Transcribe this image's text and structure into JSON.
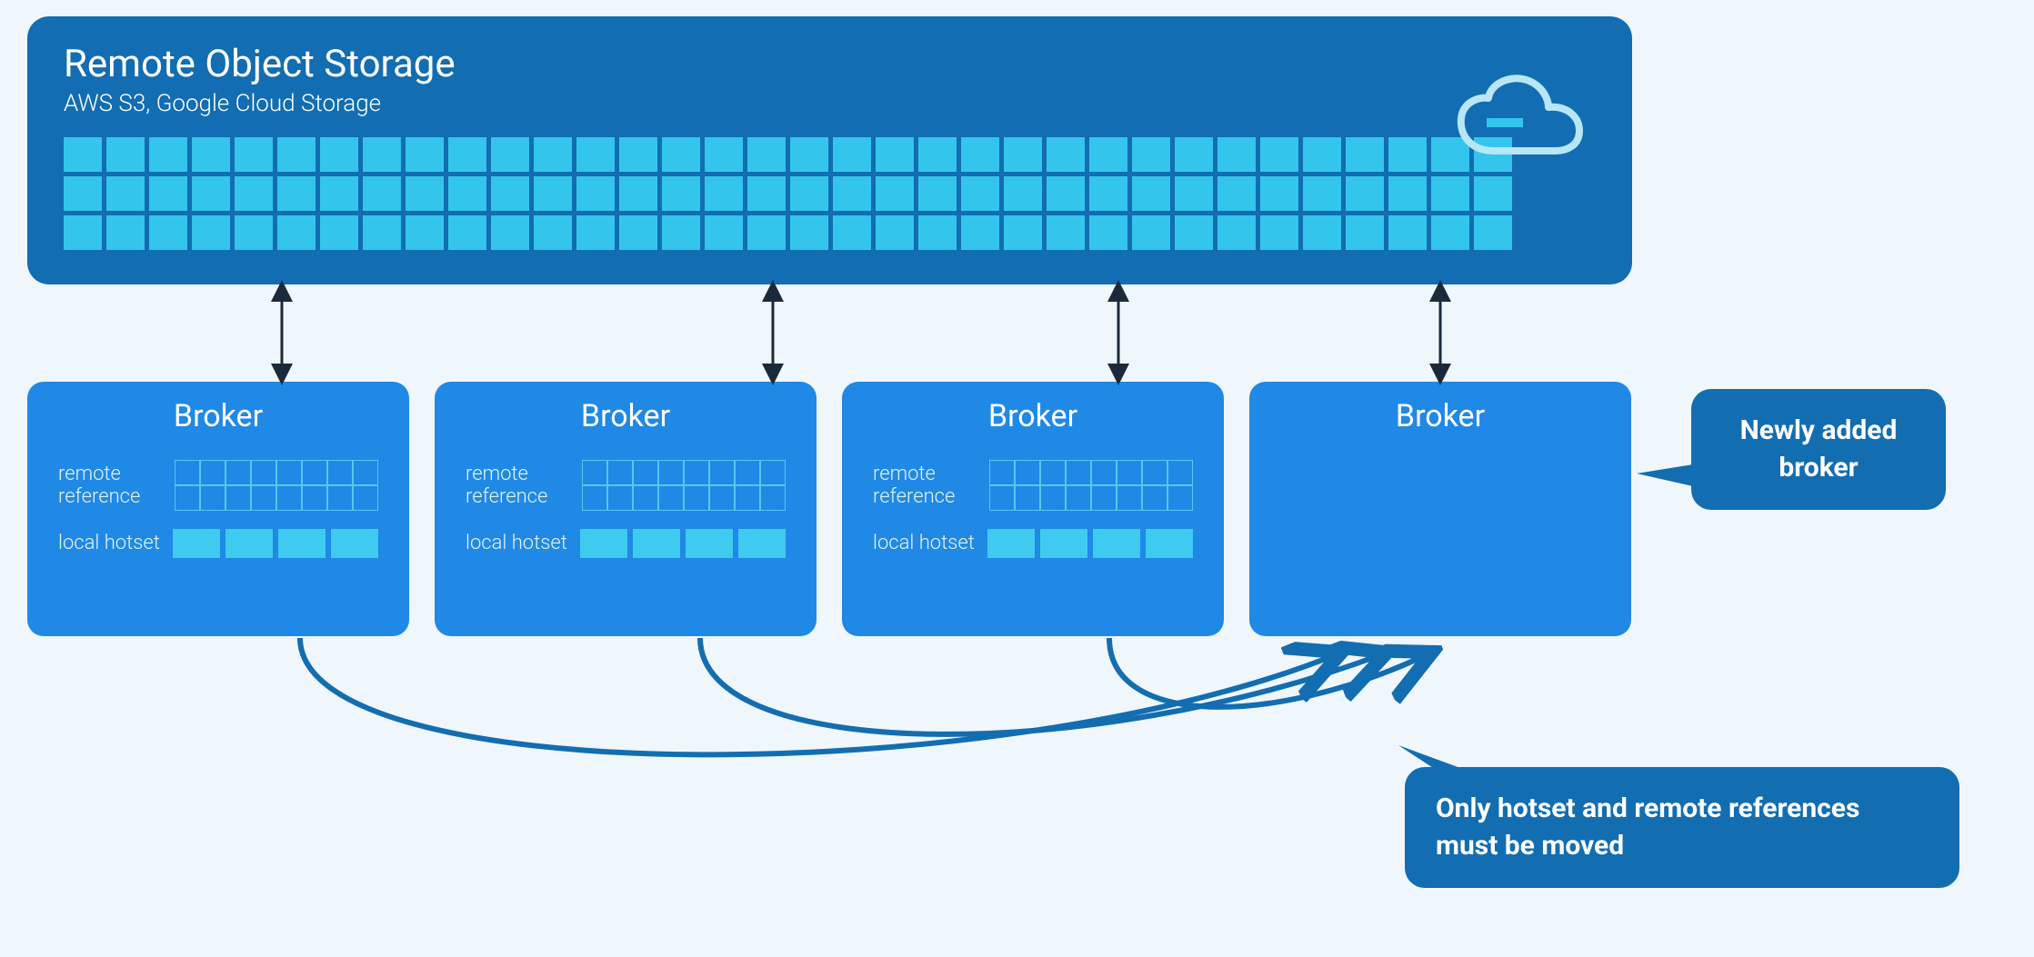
{
  "storage": {
    "title": "Remote Object Storage",
    "subtitle": "AWS S3, Google Cloud Storage",
    "grid_rows": 3,
    "grid_cols": 34
  },
  "brokers": [
    {
      "title": "Broker",
      "remote_label": "remote reference",
      "local_label": "local hotset",
      "ref_rows": 2,
      "ref_cols": 8,
      "hot_cells": 4,
      "empty": false
    },
    {
      "title": "Broker",
      "remote_label": "remote reference",
      "local_label": "local hotset",
      "ref_rows": 2,
      "ref_cols": 8,
      "hot_cells": 4,
      "empty": false
    },
    {
      "title": "Broker",
      "remote_label": "remote reference",
      "local_label": "local hotset",
      "ref_rows": 2,
      "ref_cols": 8,
      "hot_cells": 4,
      "empty": false
    },
    {
      "title": "Broker",
      "remote_label": "",
      "local_label": "",
      "ref_rows": 0,
      "ref_cols": 0,
      "hot_cells": 0,
      "empty": true
    }
  ],
  "callouts": {
    "new_broker": "Newly added broker",
    "moved": "Only hotset and remote references must be moved"
  },
  "colors": {
    "bg": "#f0f7fc",
    "storage": "#126db2",
    "broker": "#1f89e5",
    "block": "#34c5ec",
    "callout": "#136db1",
    "arrow": "#126db2"
  }
}
